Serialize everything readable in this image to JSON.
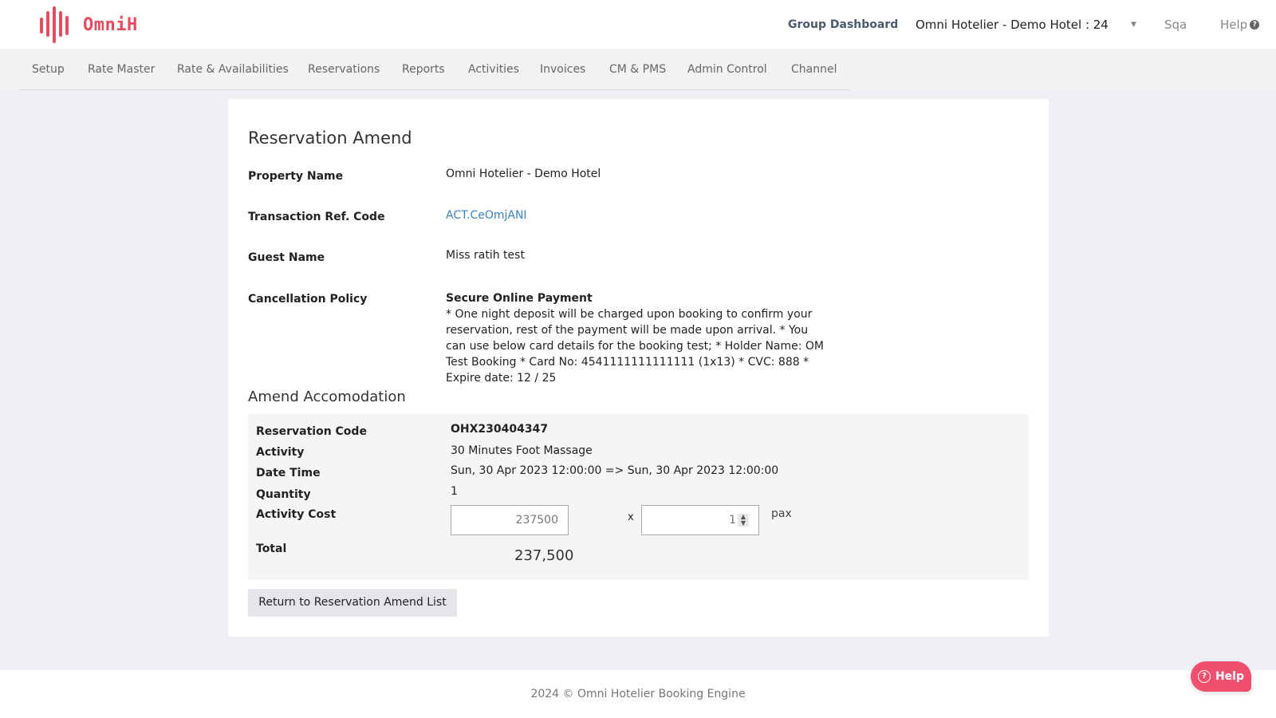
{
  "header": {
    "logo_text": "OmniH",
    "group_dashboard": "Group Dashboard",
    "hotel_selector": "Omni Hotelier - Demo Hotel : 24",
    "caret": "▼",
    "user": "Sqa",
    "help": "Help",
    "help_icon": "?"
  },
  "nav": {
    "items": [
      "Setup",
      "Rate Master",
      "Rate & Availabilities",
      "Reservations",
      "Reports",
      "Activities",
      "Invoices",
      "CM & PMS",
      "Admin Control",
      "Channel"
    ]
  },
  "reservation": {
    "title": "Reservation Amend",
    "property_label": "Property Name",
    "property_value": "Omni Hotelier - Demo Hotel",
    "transaction_label": "Transaction Ref. Code",
    "transaction_value": "ACT.CeOmjANI",
    "guest_label": "Guest Name",
    "guest_value": "Miss ratih test",
    "policy_label": "Cancellation Policy",
    "policy_title": "Secure Online Payment",
    "policy_text": "* One night deposit will be charged upon booking to confirm your reservation, rest of the payment will be made upon arrival. * You can use below card details for the booking test; * Holder Name: OM Test Booking * Card No: 4541111111111111 (1x13) * CVC: 888 * Expire date: 12 / 25"
  },
  "amend": {
    "title": "Amend Accomodation",
    "reservation_code_label": "Reservation Code",
    "reservation_code_value": "OHX230404347",
    "activity_label": "Activity",
    "activity_value": "30 Minutes Foot Massage",
    "datetime_label": "Date Time",
    "datetime_value": "Sun, 30 Apr 2023 12:00:00 => Sun, 30 Apr 2023 12:00:00",
    "quantity_label": "Quantity",
    "quantity_value": "1",
    "cost_label": "Activity Cost",
    "cost_input": "237500",
    "times": "x",
    "pax_input": "1",
    "pax_label": "pax",
    "total_label": "Total",
    "total_value": "237,500"
  },
  "buttons": {
    "return": "Return to Reservation Amend List"
  },
  "footer": {
    "text": "2024 © Omni Hotelier Booking Engine"
  },
  "floating_help": {
    "label": "Help",
    "icon": "?"
  },
  "colors": {
    "brand": "#e84a5f",
    "link": "#3b82c4",
    "help_button": "#f0506e"
  }
}
